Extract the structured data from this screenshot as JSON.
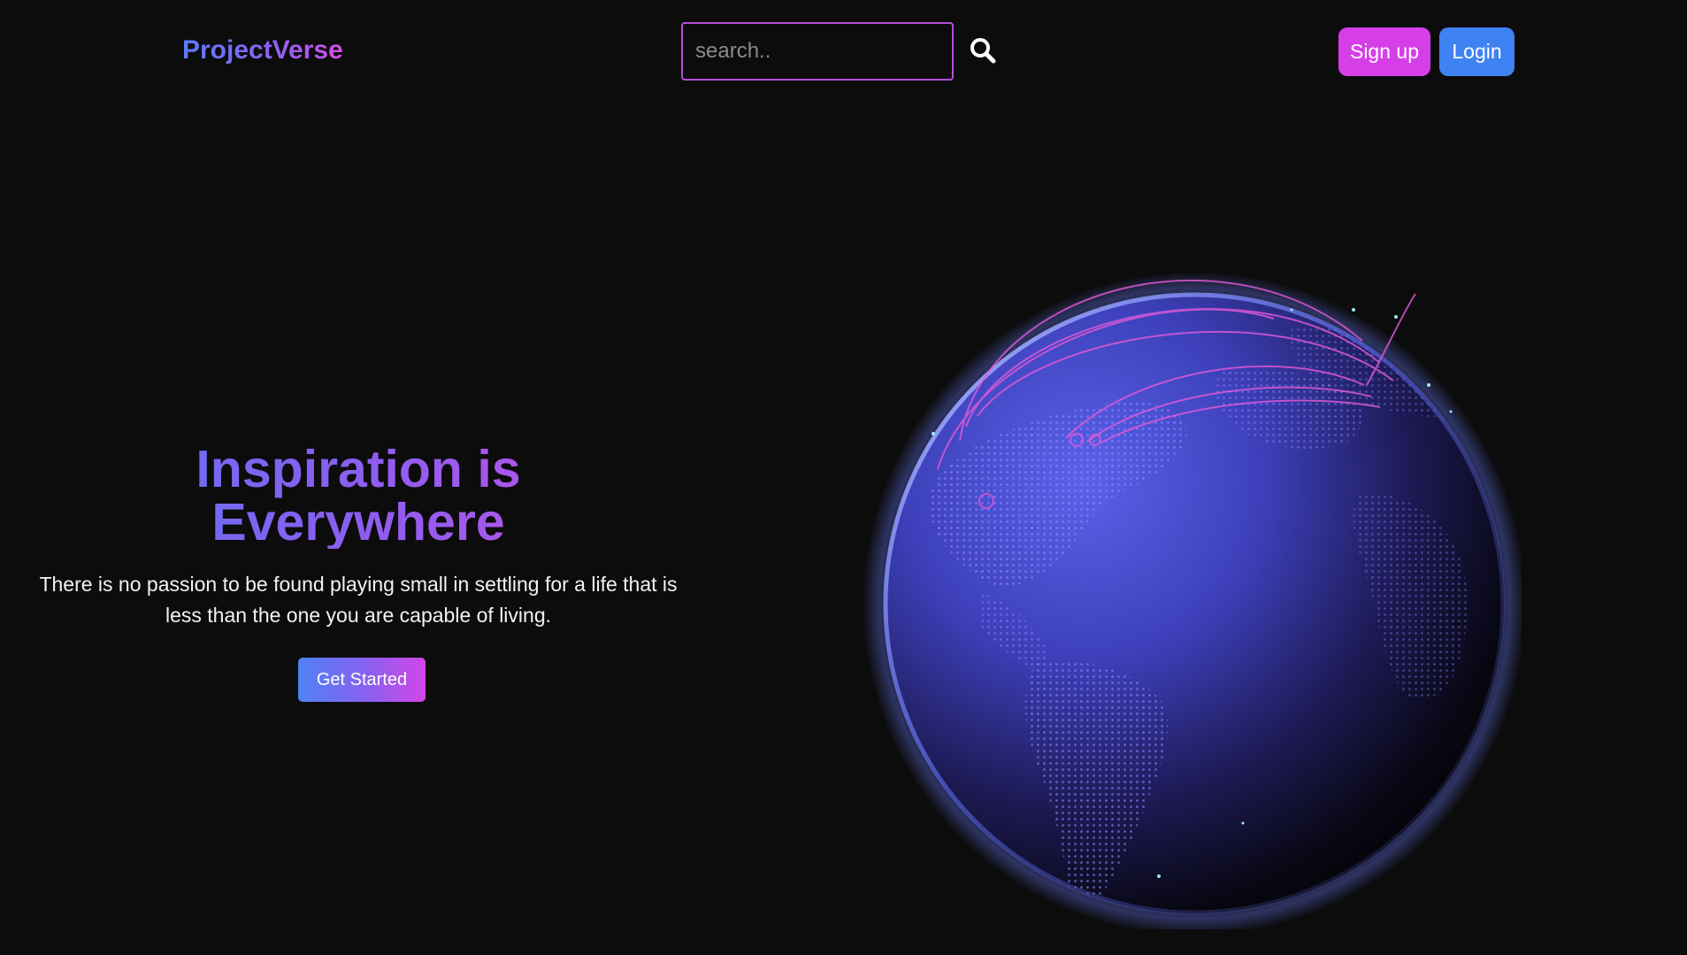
{
  "header": {
    "brand": "ProjectVerse",
    "search": {
      "placeholder": "search..",
      "value": ""
    },
    "search_icon": "search-icon",
    "signup_label": "Sign up",
    "login_label": "Login"
  },
  "hero": {
    "title_line1": "Inspiration is",
    "title_line2": "Everywhere",
    "text_line1": "There is no passion to be found playing small in settling for a life that is",
    "text_line2": "less than the one you are capable of living.",
    "cta_label": "Get Started"
  },
  "colors": {
    "background": "#0c0c0d",
    "brand_gradient_start": "#5b7cf8",
    "brand_gradient_end": "#d44ee8",
    "search_border": "#b84bd8",
    "signup": "#d63fe8",
    "login": "#3f82f2",
    "globe_glow": "#6c7cff",
    "arc": "#e25ad8"
  }
}
